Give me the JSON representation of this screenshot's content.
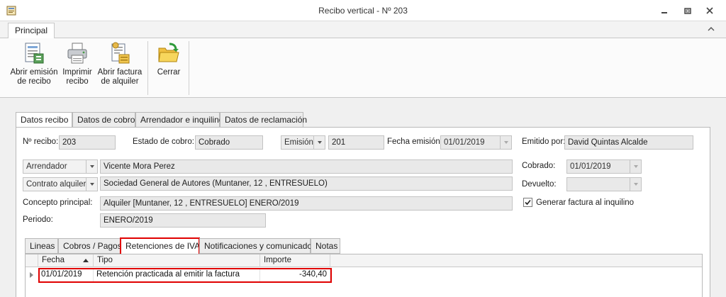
{
  "window": {
    "title": "Recibo vertical - Nº 203",
    "icons": {
      "app": "receipt-app-icon",
      "minimize": "minimize-icon",
      "restore": "restore-icon",
      "close": "close-icon"
    }
  },
  "ribbon": {
    "tab_label": "Principal",
    "buttons": [
      {
        "label1": "Abrir emisión",
        "label2": "de recibo",
        "icon": "open-issue-icon"
      },
      {
        "label1": "Imprimir",
        "label2": "recibo",
        "icon": "printer-icon"
      },
      {
        "label1": "Abrir factura",
        "label2": "de alquiler",
        "icon": "invoice-icon"
      },
      {
        "label1": "Cerrar",
        "label2": "",
        "icon": "folder-exit-icon"
      }
    ]
  },
  "tabs": [
    "Datos recibo",
    "Datos de cobro",
    "Arrendador e inquilino",
    "Datos de reclamación"
  ],
  "form": {
    "numero_label": "Nº recibo:",
    "numero": "203",
    "estado_label": "Estado de cobro:",
    "estado": "Cobrado",
    "emision_combo": "Emisión",
    "emision_num": "201",
    "fecha_emision_label": "Fecha emisión:",
    "fecha_emision": "01/01/2019",
    "emitido_label": "Emitido por:",
    "emitido_por": "David Quintas Alcalde",
    "arrendador_combo": "Arrendador",
    "arrendador": "Vicente Mora Perez",
    "contrato_combo": "Contrato alquiler",
    "contrato": "Sociedad General de Autores (Muntaner, 12 , ENTRESUELO)",
    "concepto_label": "Concepto principal:",
    "concepto": "Alquiler [Muntaner, 12 , ENTRESUELO] ENERO/2019",
    "periodo_label": "Periodo:",
    "periodo": "ENERO/2019",
    "cobrado_label": "Cobrado:",
    "cobrado": "01/01/2019",
    "devuelto_label": "Devuelto:",
    "devuelto": "",
    "generar_label": "Generar factura al inquilino",
    "generar_checked": true
  },
  "subtabs": [
    "Lineas",
    "Cobros / Pagos",
    "Retenciones de IVA",
    "Notificaciones y comunicados",
    "Notas"
  ],
  "grid": {
    "columns": [
      "Fecha",
      "Tipo",
      "Importe"
    ],
    "rows": [
      {
        "fecha": "01/01/2019",
        "tipo": "Retención practicada al emitir la factura",
        "importe": "-340,40"
      }
    ]
  },
  "colors": {
    "highlight": "#e00000",
    "field_bg": "#e9e9e9"
  }
}
